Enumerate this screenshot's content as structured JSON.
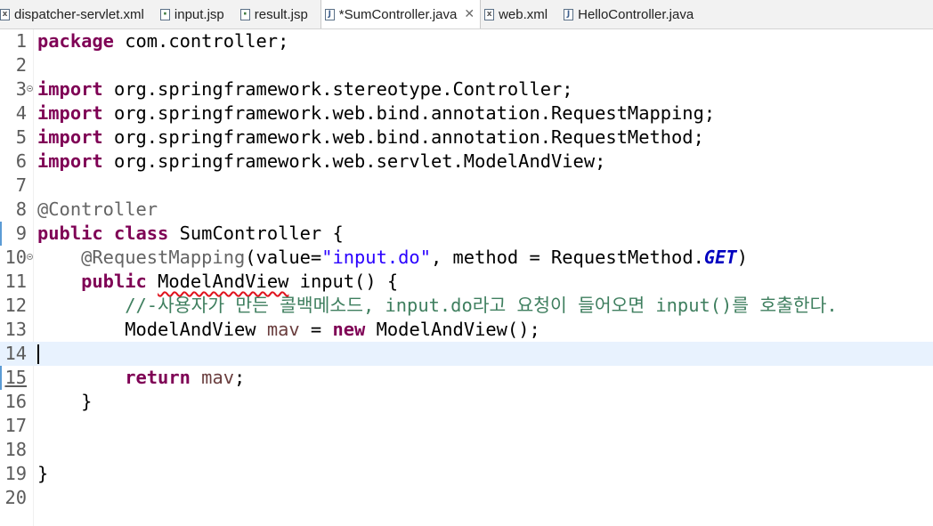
{
  "tabs": [
    {
      "label": "dispatcher-servlet.xml",
      "icon": "xml-file-icon"
    },
    {
      "label": "input.jsp",
      "icon": "jsp-file-icon"
    },
    {
      "label": "result.jsp",
      "icon": "jsp-file-icon"
    },
    {
      "label": "*SumController.java",
      "icon": "java-file-icon",
      "active": true,
      "close": "✕"
    },
    {
      "label": "web.xml",
      "icon": "xml-file-icon"
    },
    {
      "label": "HelloController.java",
      "icon": "java-file-icon"
    }
  ],
  "editor": {
    "current_line": 14,
    "lines": [
      {
        "n": "1",
        "parts": [
          [
            "kw",
            "package"
          ],
          [
            "txt",
            " com.controller;"
          ]
        ]
      },
      {
        "n": "2",
        "parts": []
      },
      {
        "n": "3",
        "fold": true,
        "parts": [
          [
            "kw",
            "import"
          ],
          [
            "txt",
            " org.springframework.stereotype.Controller;"
          ]
        ]
      },
      {
        "n": "4",
        "parts": [
          [
            "kw",
            "import"
          ],
          [
            "txt",
            " org.springframework.web.bind.annotation.RequestMapping;"
          ]
        ]
      },
      {
        "n": "5",
        "parts": [
          [
            "kw",
            "import"
          ],
          [
            "txt",
            " org.springframework.web.bind.annotation.RequestMethod;"
          ]
        ]
      },
      {
        "n": "6",
        "parts": [
          [
            "kw",
            "import"
          ],
          [
            "txt",
            " org.springframework.web.servlet.ModelAndView;"
          ]
        ]
      },
      {
        "n": "7",
        "parts": []
      },
      {
        "n": "8",
        "parts": [
          [
            "ann",
            "@Controller"
          ]
        ]
      },
      {
        "n": "9",
        "parts": [
          [
            "kw",
            "public"
          ],
          [
            "txt",
            " "
          ],
          [
            "kw",
            "class"
          ],
          [
            "txt",
            " SumController {"
          ]
        ]
      },
      {
        "n": "10",
        "fold": true,
        "parts": [
          [
            "txt",
            "    "
          ],
          [
            "ann",
            "@RequestMapping"
          ],
          [
            "txt",
            "(value="
          ],
          [
            "str",
            "\"input.do\""
          ],
          [
            "txt",
            ", method = RequestMethod."
          ],
          [
            "con",
            "GET"
          ],
          [
            "txt",
            ")"
          ]
        ]
      },
      {
        "n": "11",
        "parts": [
          [
            "txt",
            "    "
          ],
          [
            "kw",
            "public"
          ],
          [
            "txt",
            " "
          ],
          [
            "err",
            "ModelAndView"
          ],
          [
            "txt",
            " input() {"
          ]
        ]
      },
      {
        "n": "12",
        "parts": [
          [
            "txt",
            "        "
          ],
          [
            "cmt",
            "//-사용자가 만든 콜백메소드, input.do라고 요청이 들어오면 input()를 호출한다."
          ]
        ]
      },
      {
        "n": "13",
        "parts": [
          [
            "txt",
            "        ModelAndView "
          ],
          [
            "var",
            "mav"
          ],
          [
            "txt",
            " = "
          ],
          [
            "kw",
            "new"
          ],
          [
            "txt",
            " ModelAndView();"
          ]
        ]
      },
      {
        "n": "14",
        "parts": []
      },
      {
        "n": "15",
        "underline": true,
        "parts": [
          [
            "txt",
            "        "
          ],
          [
            "kw",
            "return"
          ],
          [
            "txt",
            " "
          ],
          [
            "var",
            "mav"
          ],
          [
            "txt",
            ";"
          ]
        ]
      },
      {
        "n": "16",
        "parts": [
          [
            "txt",
            "    }"
          ]
        ]
      },
      {
        "n": "17",
        "parts": []
      },
      {
        "n": "18",
        "parts": []
      },
      {
        "n": "19",
        "parts": [
          [
            "txt",
            "}"
          ]
        ]
      },
      {
        "n": "20",
        "parts": []
      }
    ]
  }
}
